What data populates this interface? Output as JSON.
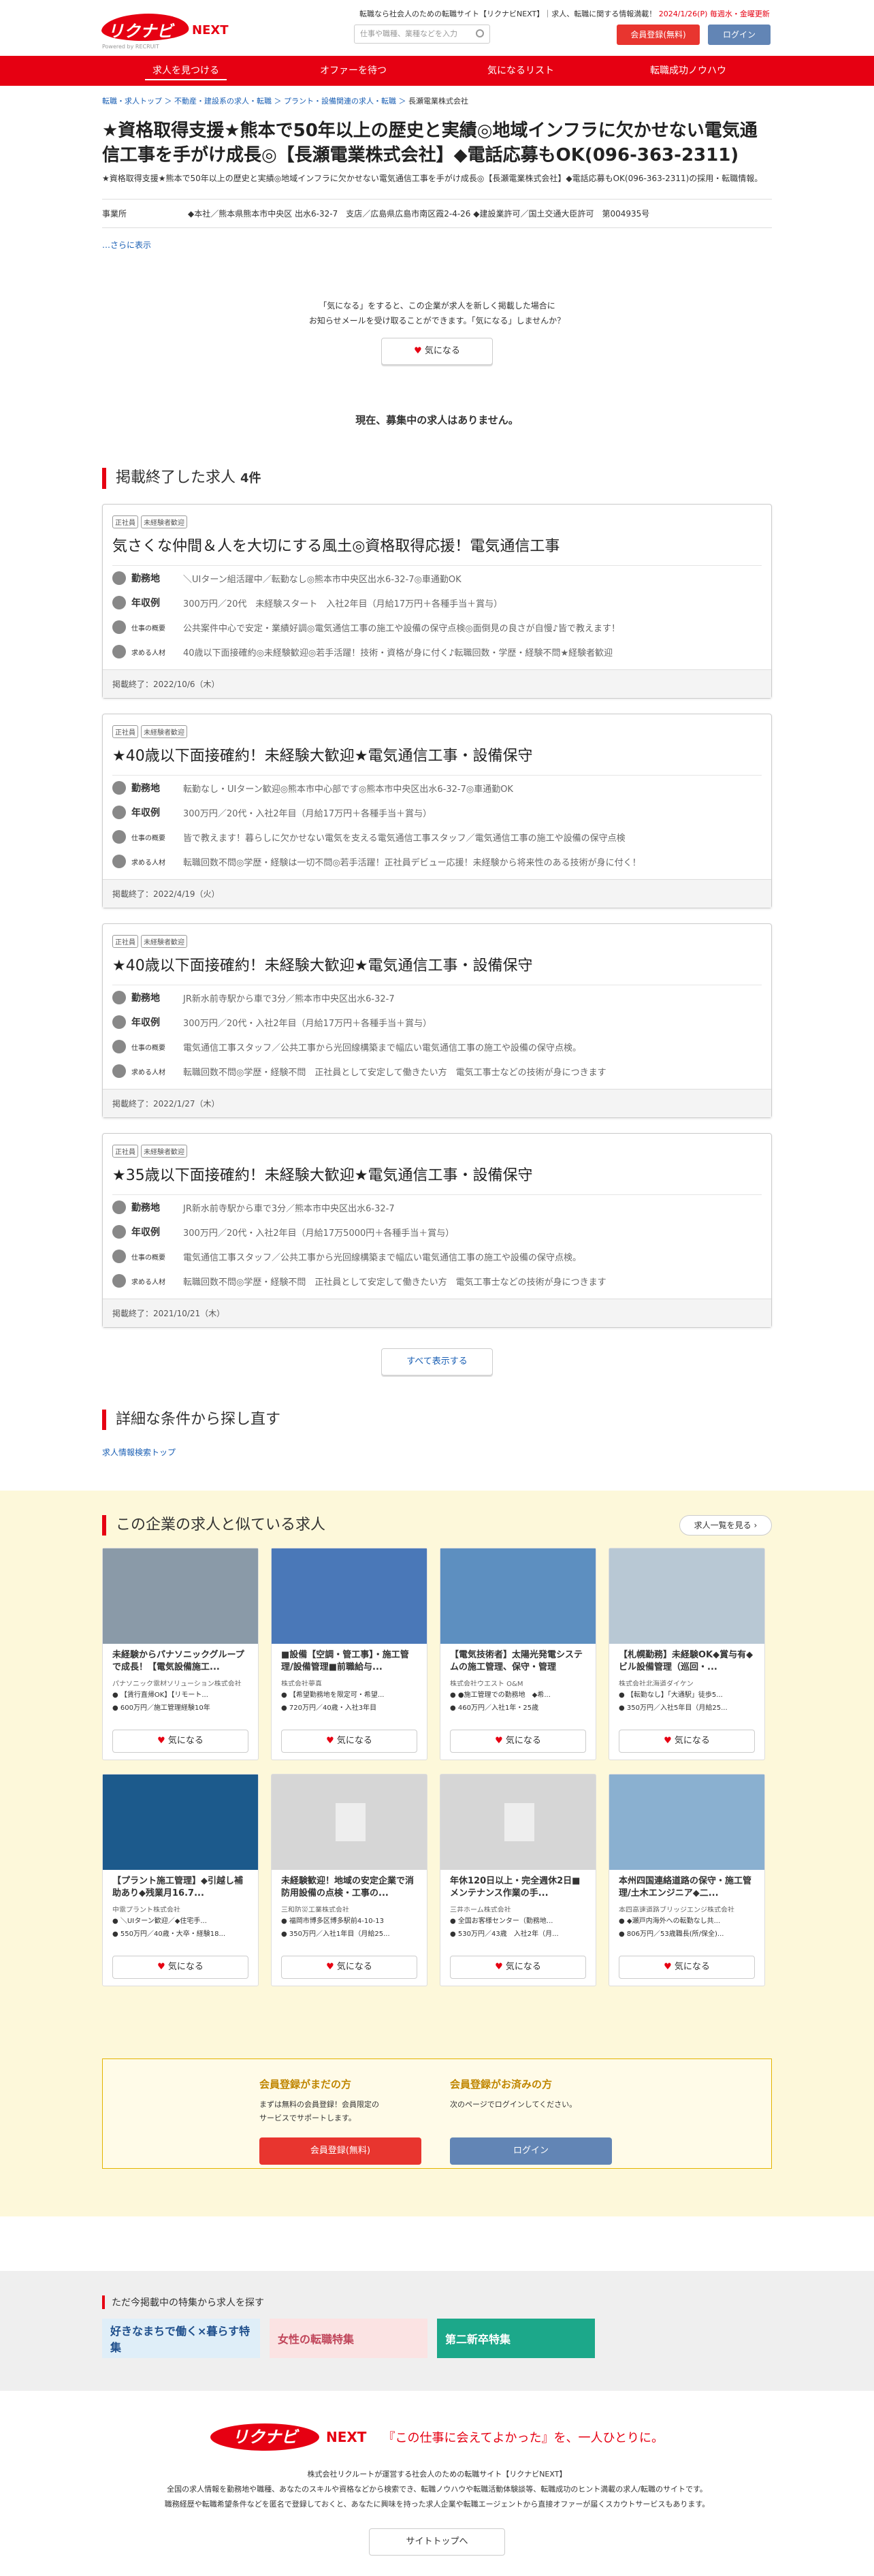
{
  "header": {
    "logo_main": "リクナビ",
    "logo_next": "NEXT",
    "logo_sub": "Powered by RECRUIT",
    "note": "転職なら社会人のための転職サイト【リクナビNEXT】｜求人、転職に関する情報満載！",
    "note_update": "2024/1/26(P) 毎週水・金曜更新",
    "search_placeholder": "仕事や職種、業種などを入力",
    "register_btn": "会員登録(無料)",
    "login_btn": "ログイン"
  },
  "nav": [
    "求人を見つける",
    "オファーを待つ",
    "気になるリスト",
    "転職成功ノウハウ"
  ],
  "breadcrumb": "転職・求人トップ ＞ 不動産・建設系の求人・転職 ＞ プラント・設備関連の求人・転職 ＞",
  "breadcrumb_current": "長瀬電業株式会社",
  "title": "★資格取得支援★熊本で50年以上の歴史と実績◎地域インフラに欠かせない電気通信工事を手がけ成長◎【長瀬電業株式会社】◆電話応募もOK(096-363-2311)",
  "title_desc": "★資格取得支援★熊本で50年以上の歴史と実績◎地域インフラに欠かせない電気通信工事を手がけ成長◎【長瀬電業株式会社】◆電話応募もOK(096-363-2311)の採用・転職情報。",
  "office": {
    "label": "事業所",
    "value": "◆本社／熊本県熊本市中央区 出水6-32-7　支店／広島県広島市南区霞2-4-26 ◆建設業許可／国土交通大臣許可　第004935号"
  },
  "more_link": "…さらに表示",
  "kininaru": {
    "line1": "「気になる」をすると、この企業が求人を新しく掲載した場合に",
    "line2": "お知らせメールを受け取ることができます。「気になる」しませんか？",
    "button": "気になる"
  },
  "no_job": "現在、募集中の求人はありません。",
  "ended": {
    "heading": "掲載終了した求人",
    "count": "4件",
    "labels": {
      "place": "勤務地",
      "salary": "年収例",
      "summary": "仕事の概要",
      "person": "求める人材"
    },
    "jobs": [
      {
        "tags": [
          "正社員",
          "未経験者歓迎"
        ],
        "title": "気さくな仲間＆人を大切にする風土◎資格取得応援！電気通信工事",
        "place": "＼UIターン組活躍中／転勤なし◎熊本市中央区出水6-32-7◎車通勤OK",
        "salary": "300万円／20代　未経験スタート　入社2年目（月給17万円＋各種手当＋賞与）",
        "summary": "公共案件中心で安定・業績好調◎電気通信工事の施工や設備の保守点検◎面倒見の良さが自慢♪皆で教えます！",
        "person": "40歳以下面接確約◎未経験歓迎◎若手活躍！技術・資格が身に付く♪転職回数・学歴・経験不問★経験者歓迎",
        "end": "掲載終了：2022/10/6（木）"
      },
      {
        "tags": [
          "正社員",
          "未経験者歓迎"
        ],
        "title": "★40歳以下面接確約！未経験大歓迎★電気通信工事・設備保守",
        "place": "転勤なし・UIターン歓迎◎熊本市中心部です◎熊本市中央区出水6-32-7◎車通勤OK",
        "salary": "300万円／20代・入社2年目（月給17万円＋各種手当＋賞与）",
        "summary": "皆で教えます！暮らしに欠かせない電気を支える電気通信工事スタッフ／電気通信工事の施工や設備の保守点検",
        "person": "転職回数不問◎学歴・経験は一切不問◎若手活躍！正社員デビュー応援！未経験から将来性のある技術が身に付く！",
        "end": "掲載終了：2022/4/19（火）"
      },
      {
        "tags": [
          "正社員",
          "未経験者歓迎"
        ],
        "title": "★40歳以下面接確約！未経験大歓迎★電気通信工事・設備保守",
        "place": "JR新水前寺駅から車で3分／熊本市中央区出水6-32-7",
        "salary": "300万円／20代・入社2年目（月給17万円＋各種手当＋賞与）",
        "summary": "電気通信工事スタッフ／公共工事から光回線構築まで幅広い電気通信工事の施工や設備の保守点検。",
        "person": "転職回数不問◎学歴・経験不問　正社員として安定して働きたい方　電気工事士などの技術が身につきます",
        "end": "掲載終了：2022/1/27（木）"
      },
      {
        "tags": [
          "正社員",
          "未経験者歓迎"
        ],
        "title": "★35歳以下面接確約！未経験大歓迎★電気通信工事・設備保守",
        "place": "JR新水前寺駅から車で3分／熊本市中央区出水6-32-7",
        "salary": "300万円／20代・入社2年目（月給17万5000円＋各種手当＋賞与）",
        "summary": "電気通信工事スタッフ／公共工事から光回線構築まで幅広い電気通信工事の施工や設備の保守点検。",
        "person": "転職回数不問◎学歴・経験不問　正社員として安定して働きたい方　電気工事士などの技術が身につきます",
        "end": "掲載終了：2021/10/21（木）"
      }
    ],
    "show_all": "すべて表示する"
  },
  "retry": {
    "heading": "詳細な条件から探し直す",
    "link": "求人情報検索トップ"
  },
  "similar": {
    "heading": "この企業の求人と似ている求人",
    "see_more": "求人一覧を見る",
    "button": "気になる",
    "cards": [
      {
        "title": "未経験からパナソニックグループで成長！【電気設備施工...",
        "company": "パナソニック電材ソリューション株式会社",
        "l1": "【賃行直帰OK】【リモート...",
        "l2": "600万円／施工管理経験10年",
        "img": "#8a9aa8"
      },
      {
        "title": "■設備【空調・管工事】・施工管理/設備管理■前職給与...",
        "company": "株式会社夢真",
        "l1": "【希望勤務地を限定可・希望...",
        "l2": "720万円／40歳・入社3年目",
        "img": "#4a78b8"
      },
      {
        "title": "【電気技術者】太陽光発電システムの施工管理、保守・管理",
        "company": "株式会社ウエスト O&M",
        "l1": "●施工管理での勤務地　◆希...",
        "l2": "460万円／入社1年・25歳",
        "img": "#5d8fc0"
      },
      {
        "title": "【札幌勤務】未経験OK◆賞与有◆ビル設備管理（巡回・...",
        "company": "株式会社北海道ダイケン",
        "l1": "【転勤なし】「大通駅」徒歩5...",
        "l2": "350万円／入社5年目（月給25...",
        "img": "#b8c8d4"
      },
      {
        "title": "【プラント施工管理】◆引越し補助あり◆残業月16.7...",
        "company": "中電プラント株式会社",
        "l1": "＼UIターン歓迎／◆住宅手...",
        "l2": "550万円／40歳・大卒・経験18...",
        "img": "#1c5a8c"
      },
      {
        "title": "未経験歓迎！地域の安定企業で消防用設備の点検・工事の...",
        "company": "三和防災工業株式会社",
        "l1": "福岡市博多区博多駅前4-10-13",
        "l2": "350万円／入社1年目（月給25...",
        "img": ""
      },
      {
        "title": "年休120日以上・完全週休2日■メンテナンス作業の手...",
        "company": "三井ホーム株式会社",
        "l1": "全国お客様センター（勤務地...",
        "l2": "530万円／43歳　入社2年（月...",
        "img": ""
      },
      {
        "title": "本州四国連絡道路の保守・施工管理/土木エンジニア◆二...",
        "company": "本四高速道路ブリッジエンジ株式会社",
        "l1": "◆瀬戸内海外への転勤なし共...",
        "l2": "806万円／53歳職長(所/保全)...",
        "img": "#8ab0d0"
      }
    ]
  },
  "member": {
    "not_yet": {
      "heading": "会員登録がまだの方",
      "text1": "まずは無料の会員登録！会員限定の",
      "text2": "サービスでサポートします。",
      "button": "会員登録(無料)"
    },
    "done": {
      "heading": "会員登録がお済みの方",
      "text": "次のページでログインしてください。",
      "button": "ログイン"
    }
  },
  "feature": {
    "heading": "ただ今掲載中の特集から求人を探す",
    "banners": [
      {
        "label": "好きなまちで働く×暮らす特集",
        "bg": "#dfeef8",
        "fg": "#1f4f8c"
      },
      {
        "label": "女性の転職特集",
        "bg": "#fbe3e3",
        "fg": "#c0455a"
      },
      {
        "label": "第二新卒特集",
        "bg": "#1ca88a",
        "fg": "#ffffff"
      }
    ]
  },
  "footer": {
    "logo_main": "リクナビ",
    "logo_next": "NEXT",
    "catch": "『この仕事に会えてよかった』を、一人ひとりに。",
    "line1": "株式会社リクルートが運営する社会人のための転職サイト【リクナビNEXT】",
    "line2": "全国の求人情報を勤務地や職種、あなたのスキルや資格などから検索でき、転職ノウハウや転職活動体験談等、転職成功のヒント満載の求人/転職のサイトです。",
    "line3": "職務経歴や転職希望条件などを匿名で登録しておくと、あなたに興味を持った求人企業や転職エージェントから直接オファーが届くスカウトサービスもあります。",
    "top_button": "サイトトップへ"
  }
}
